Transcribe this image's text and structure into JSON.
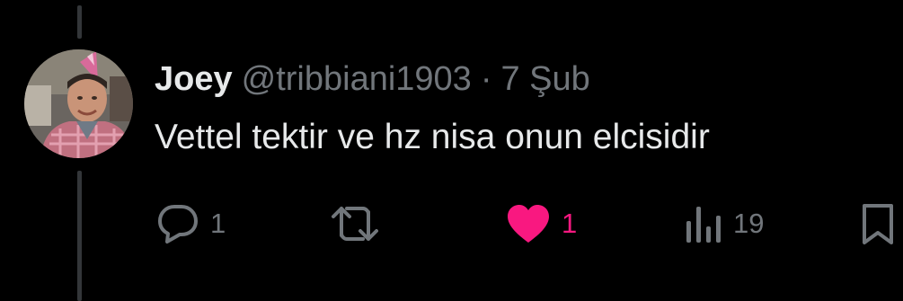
{
  "tweet": {
    "author": {
      "display_name": "Joey",
      "handle": "@tribbiani1903"
    },
    "separator": "·",
    "date": "7 Şub",
    "text": "Vettel tektir ve hz nisa onun elcisidir"
  },
  "actions": {
    "reply": {
      "icon": "reply-icon",
      "count": "1"
    },
    "retweet": {
      "icon": "retweet-icon",
      "count": ""
    },
    "like": {
      "icon": "heart-filled-icon",
      "count": "1",
      "liked": true
    },
    "views": {
      "icon": "views-chart-icon",
      "count": "19"
    },
    "bookmark": {
      "icon": "bookmark-icon"
    }
  },
  "colors": {
    "background": "#000000",
    "text_primary": "#e7e9ea",
    "text_secondary": "#71767b",
    "like_active": "#f91880",
    "thread_line": "#333639"
  }
}
